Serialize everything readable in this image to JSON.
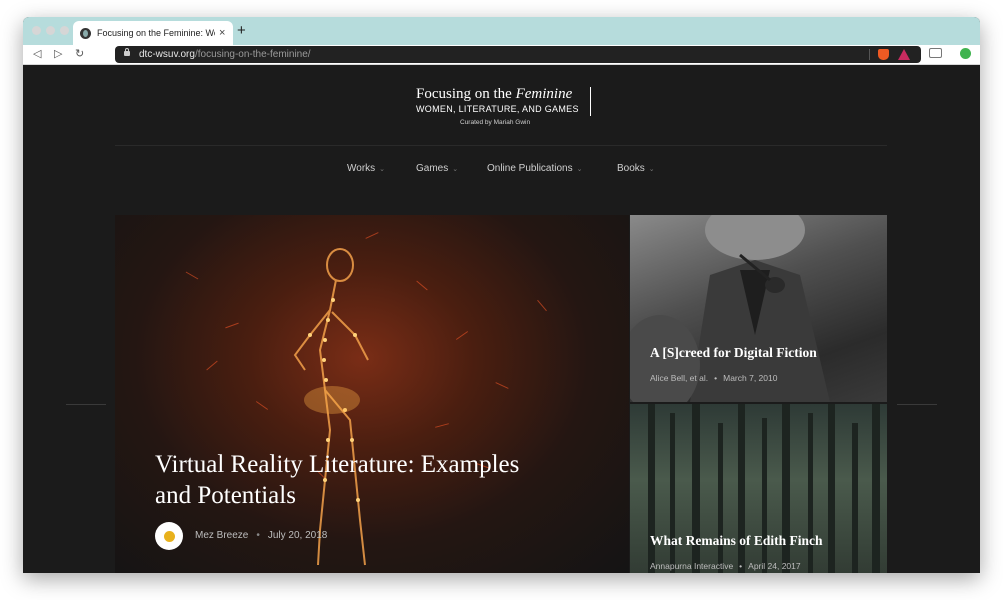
{
  "browser": {
    "tab_title": "Focusing on the Feminine: Women, Literature, and Games",
    "tab_close": "×",
    "new_tab": "+",
    "back": "◁",
    "forward": "▷",
    "reload": "↻",
    "url_domain": "dtc-wsuv.org",
    "url_path": "/focusing-on-the-feminine/"
  },
  "site": {
    "title_prefix": "Focusing on the ",
    "title_italic": "Feminine",
    "subtitle": "WOMEN, LITERATURE, AND GAMES",
    "curator": "Curated by Mariah Gwin"
  },
  "nav": {
    "chevron": "⌄",
    "items": [
      {
        "label": "Works"
      },
      {
        "label": "Games"
      },
      {
        "label": "Online Publications"
      },
      {
        "label": "Books"
      }
    ]
  },
  "hero": {
    "title": "Virtual Reality Literature: Examples and Potentials",
    "author": "Mez Breeze",
    "separator": "•",
    "date": "July 20, 2018"
  },
  "cards": [
    {
      "title": "A [S]creed for Digital Fiction",
      "author": "Alice Bell, et al.",
      "separator": "•",
      "date": "March 7, 2010"
    },
    {
      "title": "What Remains of Edith Finch",
      "author": "Annapurna Interactive",
      "separator": "•",
      "date": "April 24, 2017"
    }
  ],
  "colors": {
    "tab_strip": "#b6dcdc",
    "page_bg": "#1b1b1b",
    "text": "#ffffff"
  }
}
